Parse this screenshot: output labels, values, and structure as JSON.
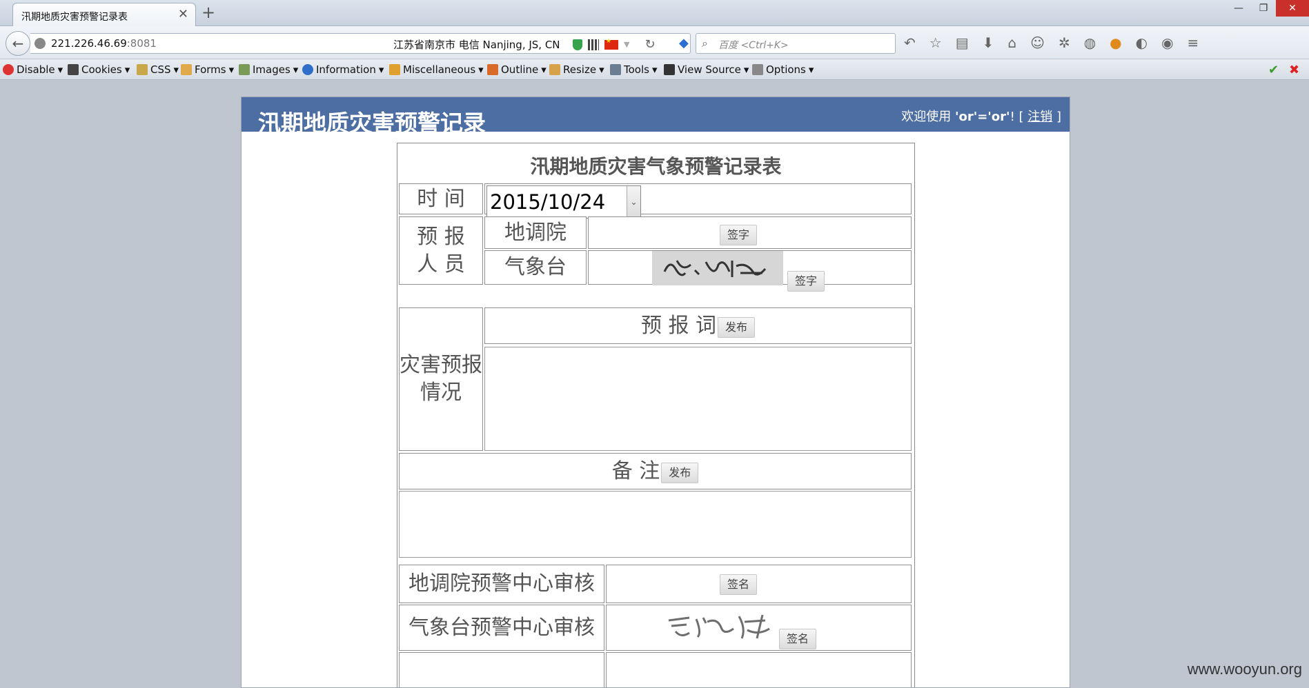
{
  "browser": {
    "tab_title": "汛期地质灾害预警记录表",
    "url_host": "221.226.46.69",
    "url_port": ":8081",
    "geo_info": "江苏省南京市 电信   Nanjing, JS, CN",
    "search_placeholder": "百度 <Ctrl+K>"
  },
  "devbar": {
    "items": [
      "Disable",
      "Cookies",
      "CSS",
      "Forms",
      "Images",
      "Information",
      "Miscellaneous",
      "Outline",
      "Resize",
      "Tools",
      "View Source",
      "Options"
    ]
  },
  "page": {
    "title": "汛期地质灾害预警记录",
    "welcome_prefix": "欢迎使用 ",
    "user": "'or'='or'",
    "welcome_suffix": "! [ ",
    "logout": "注销",
    "welcome_end": " ]"
  },
  "form": {
    "title": "汛期地质灾害气象预警记录表",
    "time_label": "时  间",
    "date_value": "2015/10/24",
    "forecasters_label_1": "预  报",
    "forecasters_label_2": "人  员",
    "geo_institute": "地调院",
    "met_station": "气象台",
    "sign_button": "签字",
    "disaster_label_1": "灾害预报",
    "disaster_label_2": "情况",
    "forecast_words": "预 报 词",
    "publish_button": "发布",
    "remarks": "备    注",
    "geo_review": "地调院预警中心审核",
    "met_review": "气象台预警中心审核",
    "signature_button": "签名"
  },
  "watermark": "www.wooyun.org"
}
